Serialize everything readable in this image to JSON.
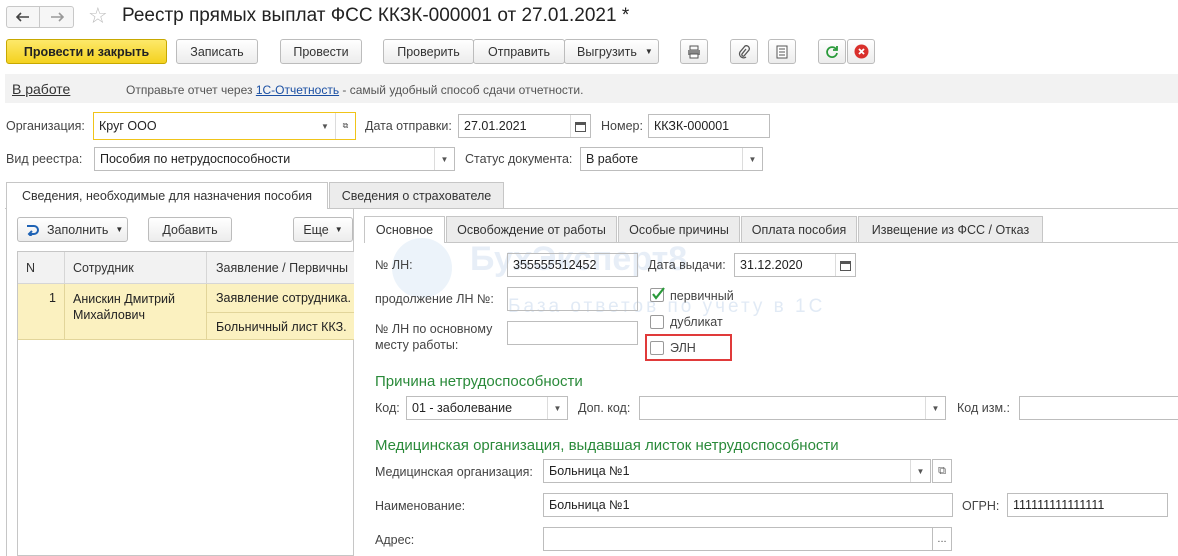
{
  "window": {
    "title": "Реестр прямых выплат ФСС ККЗК-000001 от 27.01.2021 *"
  },
  "toolbar": {
    "post_close": "Провести и закрыть",
    "save": "Записать",
    "post": "Провести",
    "check": "Проверить",
    "send": "Отправить",
    "unload": "Выгрузить"
  },
  "status_bar": {
    "state_link": "В работе",
    "hint_prefix": "Отправьте отчет через ",
    "hint_link": "1С-Отчетность",
    "hint_suffix": " - самый удобный способ сдачи отчетности."
  },
  "header_fields": {
    "org_label": "Организация:",
    "org_value": "Круг ООО",
    "date_label": "Дата отправки:",
    "date_value": "27.01.2021",
    "number_label": "Номер:",
    "number_value": "ККЗК-000001",
    "kind_label": "Вид реестра:",
    "kind_value": "Пособия по нетрудоспособности",
    "status_label": "Статус документа:",
    "status_value": "В работе"
  },
  "main_tabs": [
    {
      "label": "Сведения, необходимые для назначения пособия"
    },
    {
      "label": "Сведения о страхователе"
    }
  ],
  "left_panel": {
    "fill_button": "Заполнить",
    "add_button": "Добавить",
    "more_button": "Еще",
    "columns": [
      "N",
      "Сотрудник",
      "Заявление / Первичны"
    ],
    "rows": [
      {
        "n": "1",
        "employee": "Анискин Дмитрий Михайлович",
        "doc1": "Заявление сотрудника.",
        "doc2": "Больничный лист ККЗ."
      }
    ]
  },
  "right_tabs": [
    {
      "label": "Основное"
    },
    {
      "label": "Освобождение от работы"
    },
    {
      "label": "Особые причины"
    },
    {
      "label": "Оплата пособия"
    },
    {
      "label": "Извещение из ФСС / Отказ"
    }
  ],
  "basic": {
    "ln_label": "№ ЛН:",
    "ln_value": "355555512452",
    "issue_date_label": "Дата выдачи:",
    "issue_date_value": "31.12.2020",
    "continuation_label": "продолжение ЛН №:",
    "continuation_value": "",
    "main_job_label_1": "№ ЛН по основному",
    "main_job_label_2": "месту работы:",
    "main_job_value": "",
    "primary_label": "первичный",
    "primary_checked": true,
    "duplicate_label": "дубликат",
    "duplicate_checked": false,
    "eln_label": "ЭЛН",
    "eln_checked": false
  },
  "cause": {
    "section_title": "Причина нетрудоспособности",
    "code_label": "Код:",
    "code_value": "01 - заболевание",
    "extra_code_label": "Доп. код:",
    "extra_code_value": "",
    "change_code_label": "Код изм.:",
    "change_code_value": ""
  },
  "medical": {
    "section_title": "Медицинская организация, выдавшая листок нетрудоспособности",
    "org_label": "Медицинская организация:",
    "org_value": "Больница №1",
    "name_label": "Наименование:",
    "name_value": "Больница №1",
    "ogrn_label": "ОГРН:",
    "ogrn_value": "111111111111111",
    "address_label": "Адрес:",
    "address_value": ""
  },
  "watermark": {
    "brand": "БухЭксперт8",
    "tagline": "База ответов по учету в 1С"
  },
  "colors": {
    "accent_yellow": "#f4d21f",
    "section_green": "#2a8a3a",
    "link_blue": "#1a4fa3",
    "highlight_red": "#e03a3a",
    "selected_row": "#fbf1c0"
  }
}
